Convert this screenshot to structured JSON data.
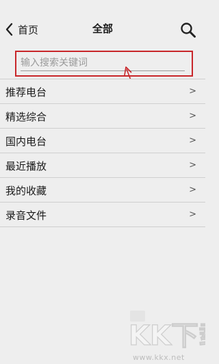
{
  "header": {
    "back_label": "首页",
    "title": "全部"
  },
  "search": {
    "placeholder": "输入搜索关键词"
  },
  "menu": {
    "items": [
      {
        "label": "推荐电台",
        "chevron": ">"
      },
      {
        "label": "精选综合",
        "chevron": ">"
      },
      {
        "label": "国内电台",
        "chevron": ">"
      },
      {
        "label": "最近播放",
        "chevron": ">"
      },
      {
        "label": "我的收藏",
        "chevron": ">"
      },
      {
        "label": "录音文件",
        "chevron": ">"
      }
    ]
  },
  "watermark": {
    "logo_text": "KK下载",
    "url": "www.kkx.net"
  },
  "colors": {
    "background": "#eeeeee",
    "annotation_red": "#c8262a",
    "divider": "#cfcfcf"
  },
  "icons": {
    "back": "chevron-left-icon",
    "search": "search-icon"
  }
}
